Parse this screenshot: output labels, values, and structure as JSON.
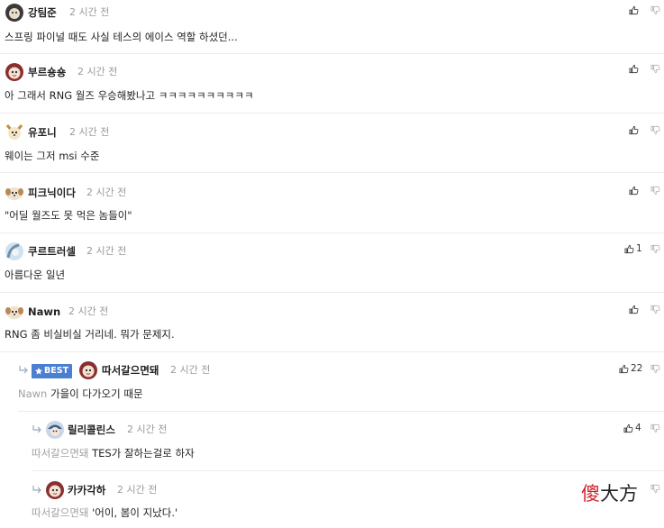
{
  "icons": {
    "like": "thumbs-up-icon",
    "dislike": "thumbs-down-icon",
    "reply": "reply-arrow-icon",
    "best": "star-icon"
  },
  "colors": {
    "best_badge": "#4a7fd1",
    "mention": "#a0a0a0",
    "time": "#9a9a9a",
    "watermark_red": "#d0202a"
  },
  "comments": [
    {
      "nickname": "강팀준",
      "time": "2 시간 전",
      "text": "스프링 파이널 때도 사실 테스의 에이스 역할 하셨던..."
    },
    {
      "nickname": "부르숑숑",
      "time": "2 시간 전",
      "text": "아 그래서 RNG 월즈 우승해봤나고 ㅋㅋㅋㅋㅋㅋㅋㅋㅋㅋ"
    },
    {
      "nickname": "유포니",
      "time": "2 시간 전",
      "text": "웨이는 그저 msi 수준"
    },
    {
      "nickname": "피크닉이다",
      "time": "2 시간 전",
      "text": "\"어딜 월즈도 못 먹은 놈들이\""
    },
    {
      "nickname": "쿠르트러셀",
      "time": "2 시간 전",
      "text": "아름다운 일년",
      "likes": "1"
    },
    {
      "nickname": "Nawn",
      "time": "2 시간 전",
      "text": "RNG 좀 비실비실 거리네. 뭐가 문제지."
    }
  ],
  "replies": [
    {
      "badge": "BEST",
      "nickname": "따서갈으면돼",
      "time": "2 시간 전",
      "mention": "Nawn",
      "text": "가을이 다가오기 때문",
      "likes": "22"
    },
    {
      "nickname": "릴리콜린스",
      "time": "2 시간 전",
      "mention": "따서갈으면돼",
      "text": "TES가 잘하는걸로 하자",
      "likes": "4"
    },
    {
      "nickname": "카카각하",
      "time": "2 시간 전",
      "mention": "따서갈으면돼",
      "text": "'어이, 봄이 지났다.'"
    }
  ],
  "watermark": {
    "red": "傻",
    "black": "大方"
  }
}
